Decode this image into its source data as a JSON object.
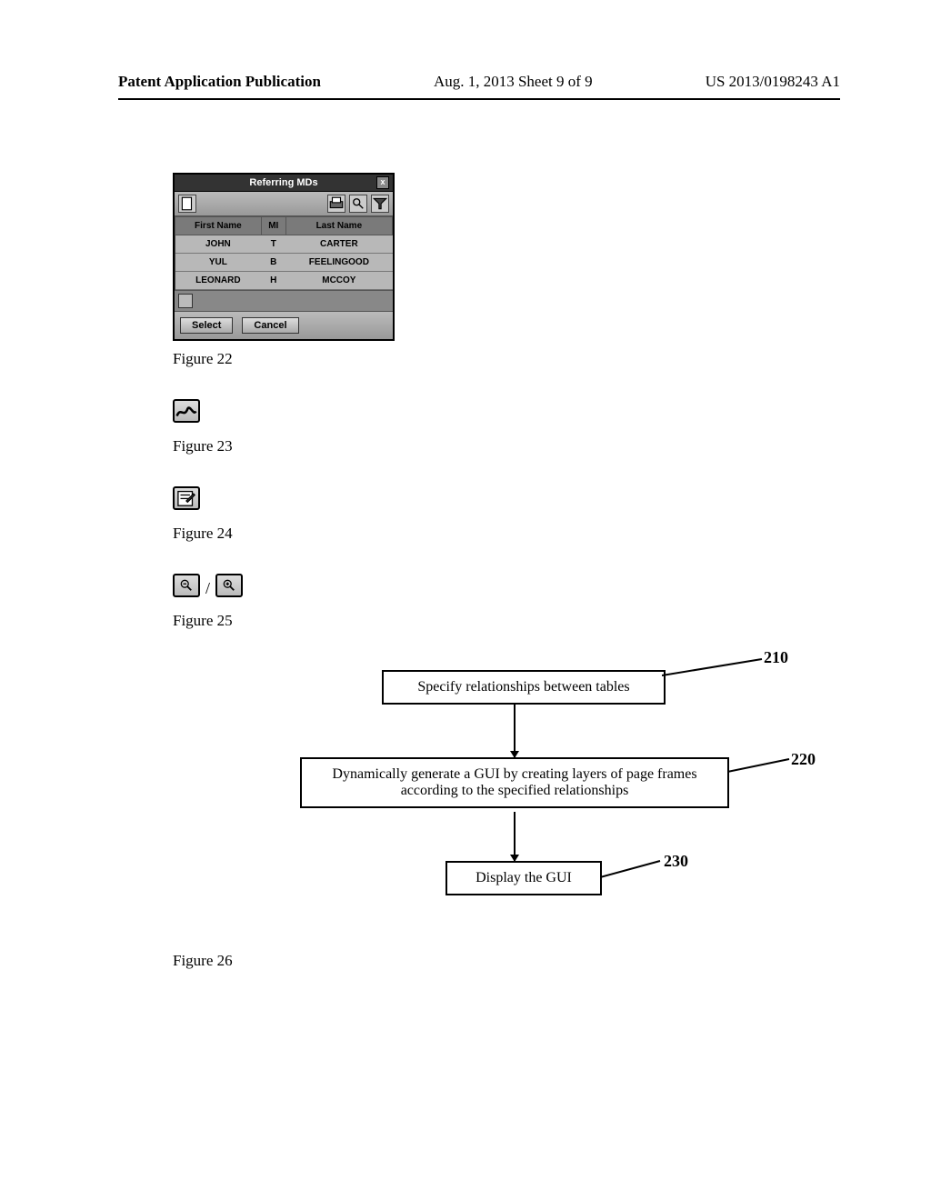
{
  "header": {
    "left": "Patent Application Publication",
    "center": "Aug. 1, 2013  Sheet 9 of 9",
    "right": "US 2013/0198243 A1"
  },
  "fig22": {
    "title": "Referring MDs",
    "columns": [
      "First Name",
      "MI",
      "Last Name"
    ],
    "rows": [
      {
        "first": "JOHN",
        "mi": "T",
        "last": "CARTER"
      },
      {
        "first": "YUL",
        "mi": "B",
        "last": "FEELINGOOD"
      },
      {
        "first": "LEONARD",
        "mi": "H",
        "last": "MCCOY"
      }
    ],
    "select": "Select",
    "cancel": "Cancel",
    "label": "Figure 22"
  },
  "fig23": {
    "label": "Figure 23"
  },
  "fig24": {
    "label": "Figure 24"
  },
  "fig25": {
    "label": "Figure 25",
    "sep": "/"
  },
  "fig26": {
    "step1": "Specify relationships between tables",
    "step2": "Dynamically generate a GUI by creating layers of page frames according to the specified relationships",
    "step3": "Display the GUI",
    "ref1": "210",
    "ref2": "220",
    "ref3": "230",
    "label": "Figure 26"
  }
}
